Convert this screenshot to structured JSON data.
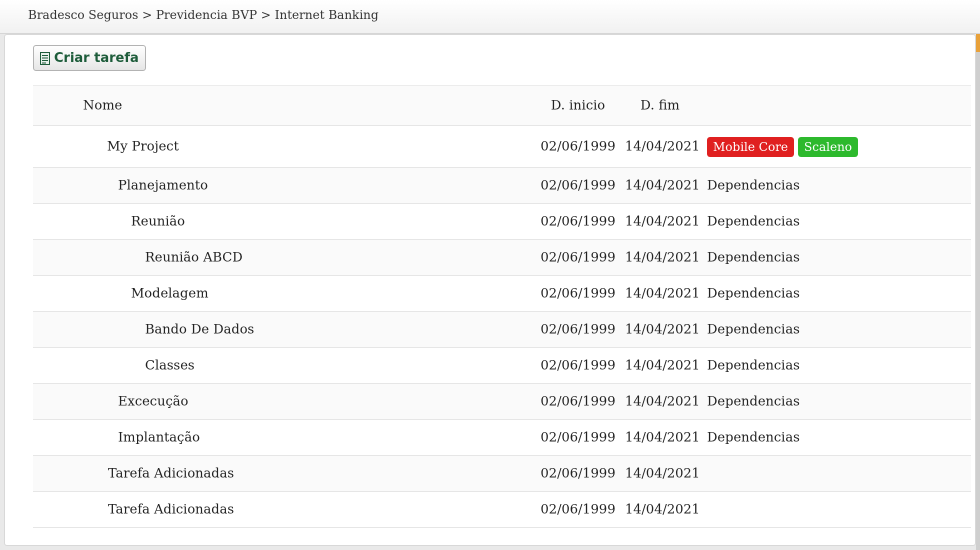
{
  "breadcrumb": "Bradesco Seguros > Previdencia BVP > Internet Banking",
  "toolbar": {
    "create_task_label": "Criar tarefa",
    "create_task_icon": "document-icon"
  },
  "table": {
    "headers": {
      "name": "Nome",
      "start": "D. inicio",
      "end": "D. fim"
    },
    "rows": [
      {
        "name": "My Project",
        "level": 0,
        "start": "02/06/1999",
        "end": "14/04/2021",
        "tags": [
          {
            "label": "Mobile Core",
            "color": "#e02020"
          },
          {
            "label": "Scaleno",
            "color": "#2db92d"
          }
        ],
        "dependency": ""
      },
      {
        "name": "Planejamento",
        "level": 1,
        "start": "02/06/1999",
        "end": "14/04/2021",
        "dependency": "Dependencias"
      },
      {
        "name": "Reunião",
        "level": 2,
        "start": "02/06/1999",
        "end": "14/04/2021",
        "dependency": "Dependencias"
      },
      {
        "name": "Reunião ABCD",
        "level": 3,
        "start": "02/06/1999",
        "end": "14/04/2021",
        "dependency": "Dependencias"
      },
      {
        "name": "Modelagem",
        "level": 2,
        "start": "02/06/1999",
        "end": "14/04/2021",
        "dependency": "Dependencias"
      },
      {
        "name": "Bando De Dados",
        "level": 3,
        "start": "02/06/1999",
        "end": "14/04/2021",
        "dependency": "Dependencias"
      },
      {
        "name": "Classes",
        "level": 3,
        "start": "02/06/1999",
        "end": "14/04/2021",
        "dependency": "Dependencias"
      },
      {
        "name": "Excecução",
        "level": 1,
        "start": "02/06/1999",
        "end": "14/04/2021",
        "dependency": "Dependencias"
      },
      {
        "name": "Implantação",
        "level": 1,
        "start": "02/06/1999",
        "end": "14/04/2021",
        "dependency": "Dependencias"
      },
      {
        "name": "Tarefa Adicionadas",
        "level": 0,
        "start": "02/06/1999",
        "end": "14/04/2021",
        "dependency": ""
      },
      {
        "name": "Tarefa Adicionadas",
        "level": 0,
        "start": "02/06/1999",
        "end": "14/04/2021",
        "dependency": ""
      }
    ]
  }
}
